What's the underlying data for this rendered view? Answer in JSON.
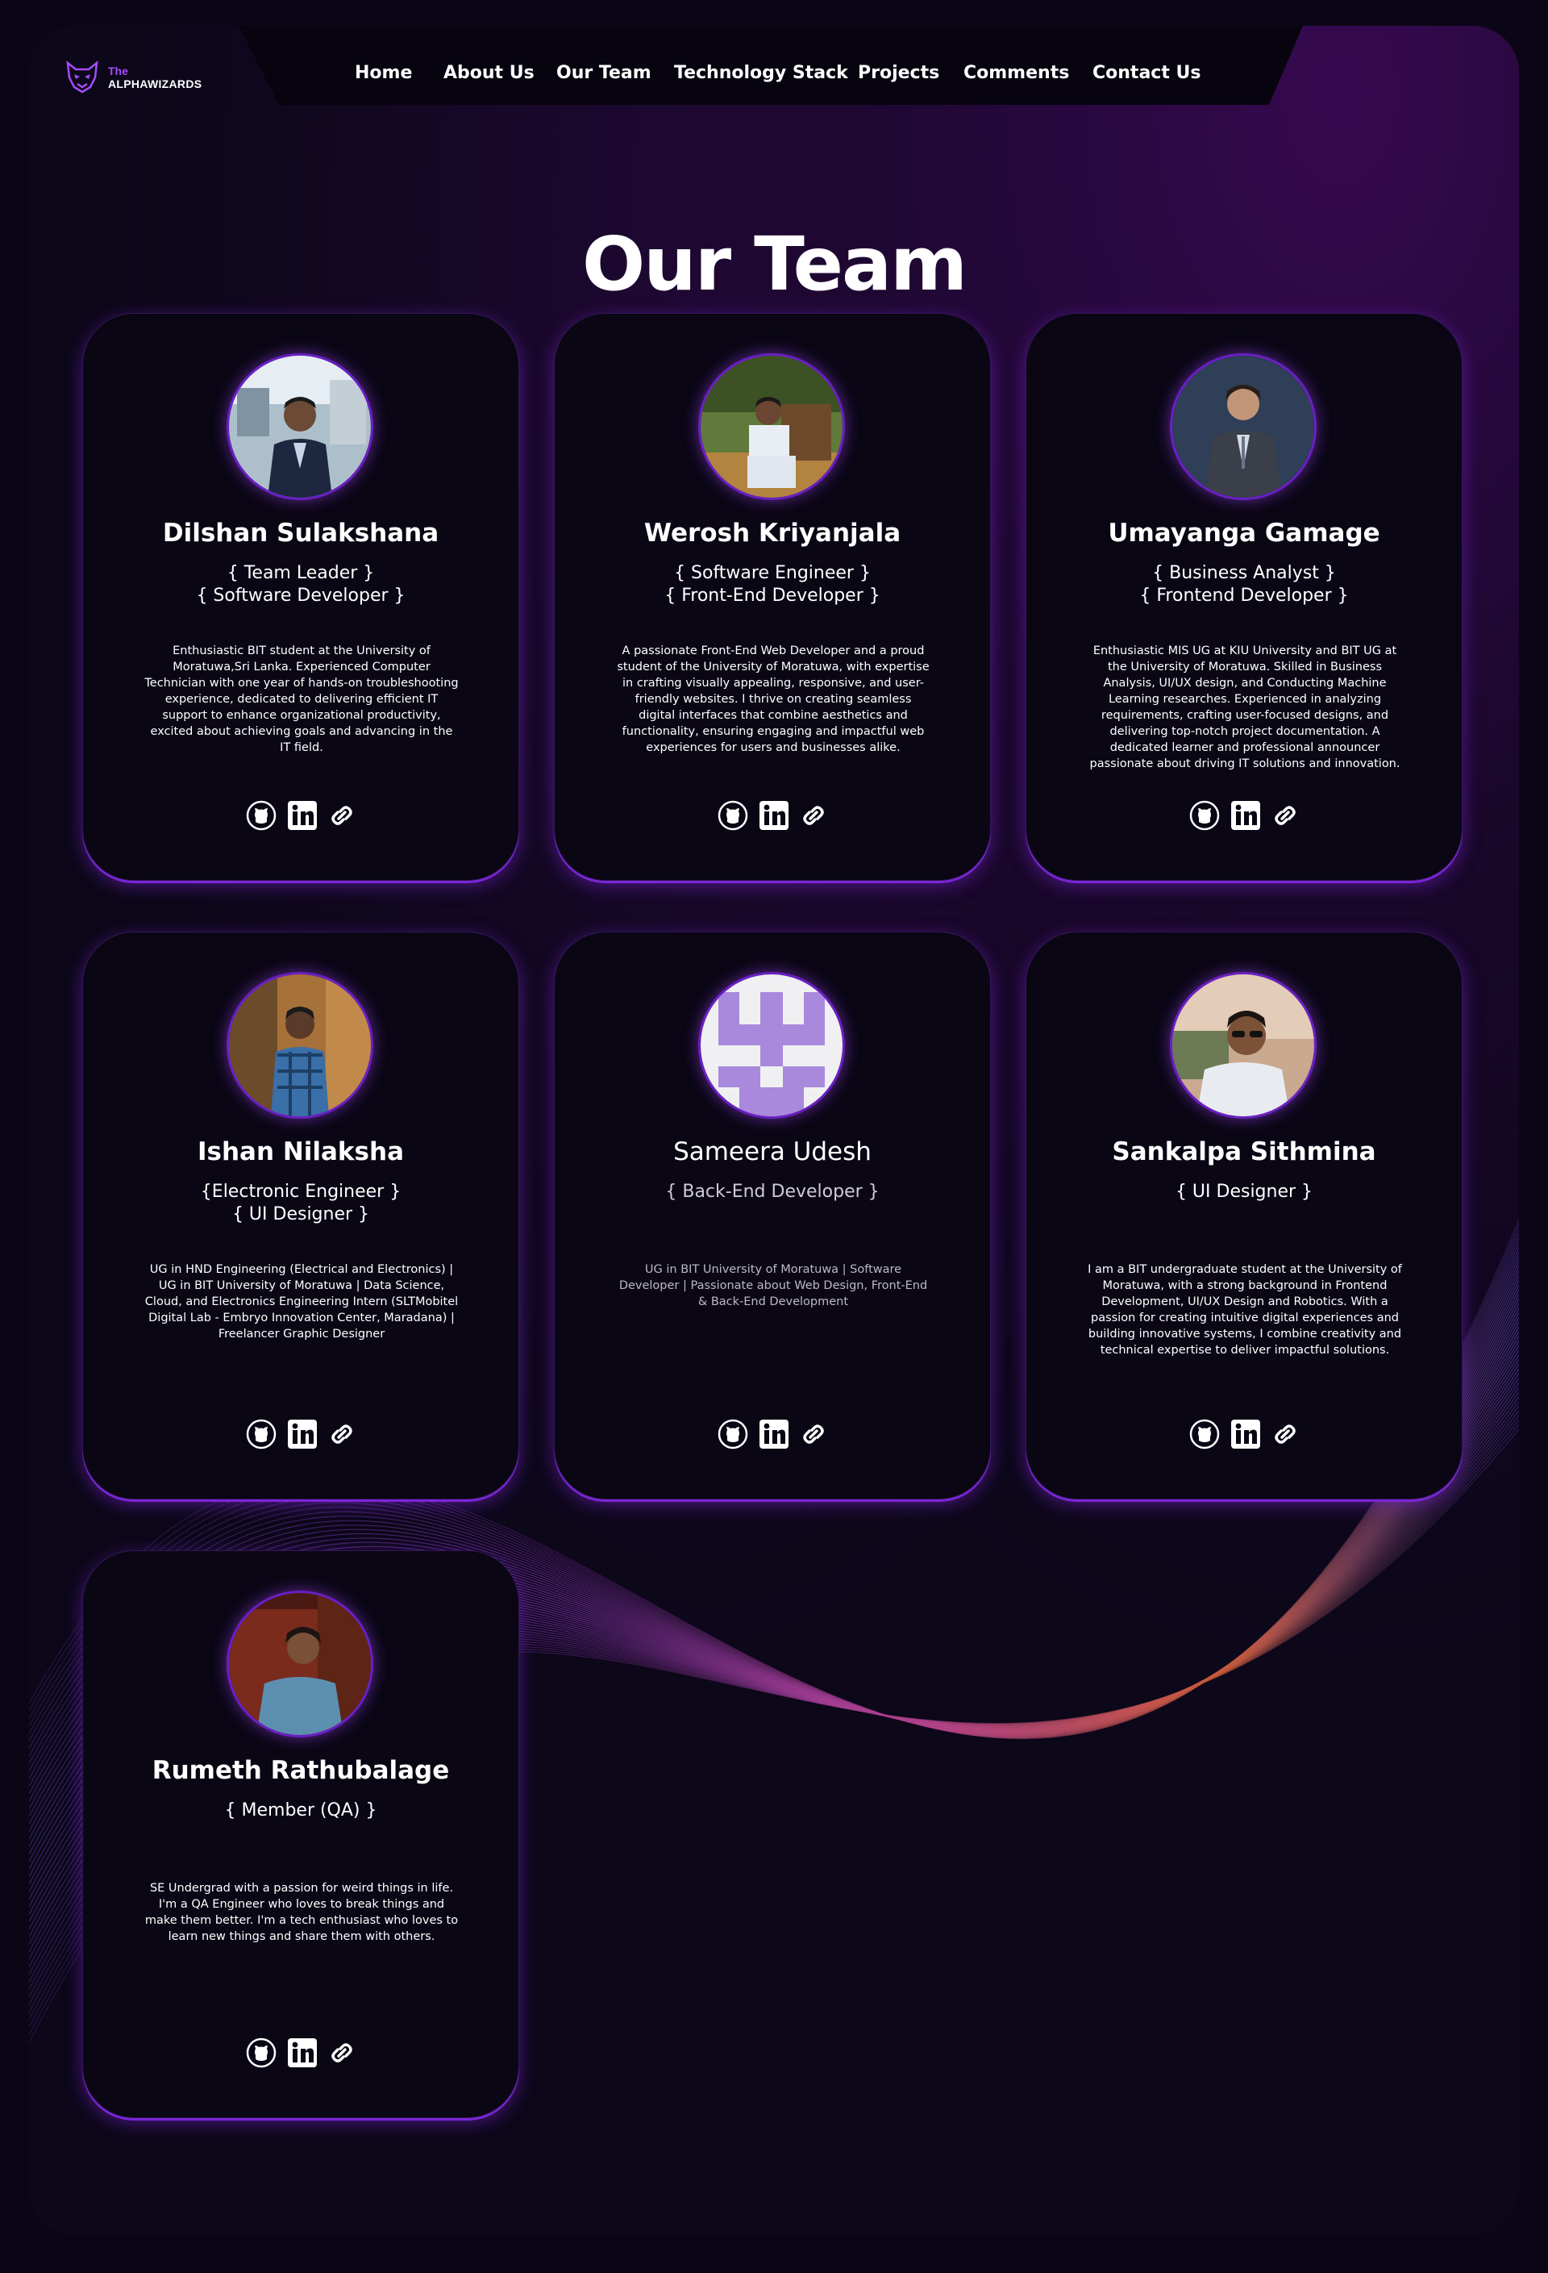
{
  "brand": {
    "the": "The",
    "name": "ALPHAWIZARDS",
    "accent": "#a64bff"
  },
  "nav": {
    "home": "Home",
    "about": "About Us",
    "team": "Our Team",
    "tech": "Technology Stack",
    "projects": "Projects",
    "comments": "Comments",
    "contact": "Contact Us"
  },
  "page": {
    "title": "Our Team"
  },
  "icons": {
    "github": "github-icon",
    "linkedin": "linkedin-icon",
    "link": "link-icon"
  },
  "team": [
    {
      "name": "Dilshan Sulakshana",
      "role1": "{ Team Leader }",
      "role2": "{ Software Developer }",
      "bio": "Enthusiastic BIT student at the University of Moratuwa,Sri Lanka. Experienced Computer Technician with one year of hands-on troubleshooting experience, dedicated to delivering efficient IT support to enhance organizational productivity, excited about achieving goals and advancing in the IT field."
    },
    {
      "name": "Werosh Kriyanjala",
      "role1": "{ Software Engineer }",
      "role2": "{ Front-End Developer }",
      "bio": "A passionate Front-End Web Developer and a proud student of the University of Moratuwa, with expertise in crafting visually appealing, responsive, and user-friendly websites. I thrive on creating seamless digital interfaces that combine aesthetics and functionality, ensuring engaging and impactful web experiences for users and businesses alike."
    },
    {
      "name": "Umayanga Gamage",
      "role1": "{ Business Analyst }",
      "role2": "{ Frontend Developer }",
      "bio": "Enthusiastic MIS UG at KIU University and BIT UG at the University of Moratuwa. Skilled in Business Analysis, UI/UX design, and Conducting Machine Learning researches. Experienced in analyzing requirements, crafting user-focused designs, and delivering top-notch project documentation. A dedicated learner and professional announcer passionate about driving IT solutions and innovation."
    },
    {
      "name": "Ishan Nilaksha",
      "role1": "{Electronic Engineer }",
      "role2": "{ UI Designer }",
      "bio": "UG in HND Engineering (Electrical and Electronics) | UG in BIT University of Moratuwa | Data Science, Cloud, and Electronics Engineering Intern (SLTMobitel Digital Lab - Embryo Innovation Center, Maradana) | Freelancer Graphic Designer"
    },
    {
      "name": "Sameera Udesh",
      "role1": "{ Back-End Developer }",
      "role2": "",
      "bio": "UG in BIT University of Moratuwa | Software Developer | Passionate about Web Design, Front-End & Back-End Development"
    },
    {
      "name": "Sankalpa Sithmina",
      "role1": "{ UI Designer }",
      "role2": "",
      "bio": "I am a BIT undergraduate student at the University of Moratuwa, with a strong background in Frontend Development, UI/UX Design and Robotics. With a passion for creating intuitive digital experiences and building innovative systems, I combine creativity and technical expertise to deliver impactful solutions."
    },
    {
      "name": "Rumeth Rathubalage",
      "role1": "{ Member (QA) }",
      "role2": "",
      "bio": "SE Undergrad with a passion for weird things in life. I'm a QA Engineer who loves to break things and make them better. I'm a tech enthusiast who loves to learn new things and share them with others."
    }
  ]
}
